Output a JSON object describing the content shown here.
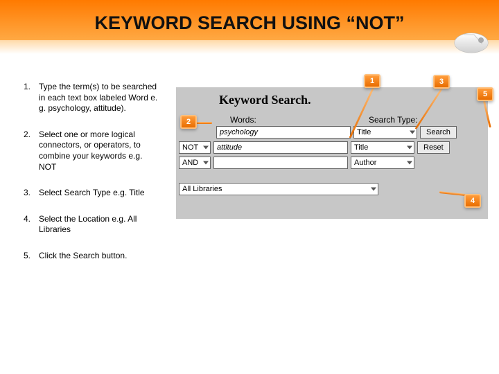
{
  "title": "KEYWORD SEARCH USING “NOT”",
  "instructions": [
    {
      "n": "1.",
      "text": "Type the term(s) to be searched in each text box labeled Word  e. g. psychology, attitude)."
    },
    {
      "n": "2.",
      "text": "Select one or more logical connectors, or operators, to combine your keywords e.g. NOT"
    },
    {
      "n": "3.",
      "text": "Select Search Type e.g. Title"
    },
    {
      "n": "4.",
      "text": "Select  the Location e.g. All Libraries"
    },
    {
      "n": "5.",
      "text": "Click the Search button."
    }
  ],
  "panel": {
    "heading": "Keyword Search.",
    "labels": {
      "words": "Words:",
      "search_type": "Search Type:"
    },
    "rows": [
      {
        "connector": "",
        "word": "psychology",
        "stype": "Title"
      },
      {
        "connector": "NOT",
        "word": "attitude",
        "stype": "Title"
      },
      {
        "connector": "AND",
        "word": "",
        "stype": "Author"
      }
    ],
    "location": "All Libraries",
    "buttons": {
      "search": "Search",
      "reset": "Reset"
    }
  },
  "callouts": {
    "c1": "1",
    "c2": "2",
    "c3": "3",
    "c4": "4",
    "c5": "5"
  }
}
